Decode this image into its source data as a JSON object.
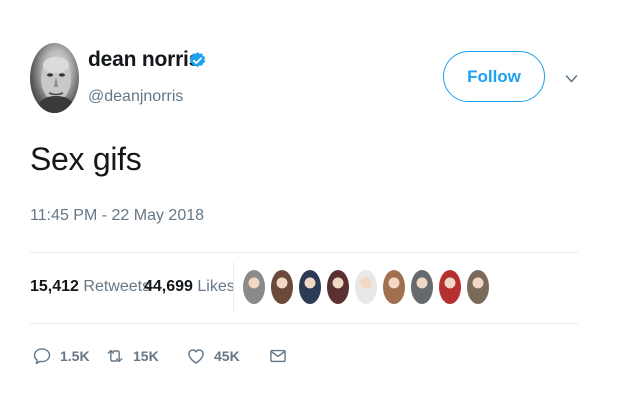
{
  "user": {
    "name": "dean norris",
    "handle": "@deanjnorris",
    "verified": true,
    "follow_label": "Follow"
  },
  "tweet": {
    "text": "Sex gifs",
    "timestamp": "11:45 PM - 22 May 2018"
  },
  "stats": {
    "retweets_count": "15,412",
    "retweets_label": "Retweets",
    "likes_count": "44,699",
    "likes_label": "Likes"
  },
  "likers": [
    {
      "color": "#8a8a8a"
    },
    {
      "color": "#6b4a3a"
    },
    {
      "color": "#2d3a55"
    },
    {
      "color": "#5a3030"
    },
    {
      "color": "#e8e8e8"
    },
    {
      "color": "#a07050"
    },
    {
      "color": "#666a6e"
    },
    {
      "color": "#b53030"
    },
    {
      "color": "#7a6a5a"
    }
  ],
  "actions": {
    "reply_count": "1.5K",
    "retweet_count": "15K",
    "like_count": "45K"
  },
  "colors": {
    "accent": "#1da1f2",
    "secondary_text": "#657786",
    "divider": "#e6ecf0"
  },
  "icons": {
    "verified": "verified-badge-icon",
    "caret": "chevron-down-icon",
    "reply": "reply-icon",
    "retweet": "retweet-icon",
    "like": "heart-icon",
    "message": "envelope-icon"
  }
}
